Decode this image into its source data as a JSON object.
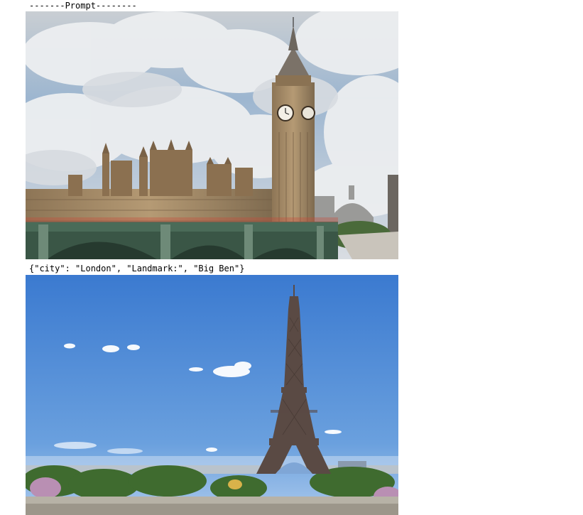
{
  "prompt": {
    "header": "-------Prompt--------"
  },
  "json_snippet": {
    "text": "{\"city\": \"London\", \"Landmark:\", \"Big Ben\"}"
  },
  "images": {
    "london": {
      "subject": "big-ben-westminster-photo"
    },
    "paris": {
      "subject": "eiffel-tower-photo"
    }
  },
  "colors": {
    "sky_london": "#8fb0cf",
    "cloud": "#e9ebee",
    "stone": "#a48a68",
    "bridge": "#3e5a4a",
    "sky_paris": "#3d7dd0",
    "tower": "#5a4a44",
    "trees": "#3f6b2f"
  }
}
